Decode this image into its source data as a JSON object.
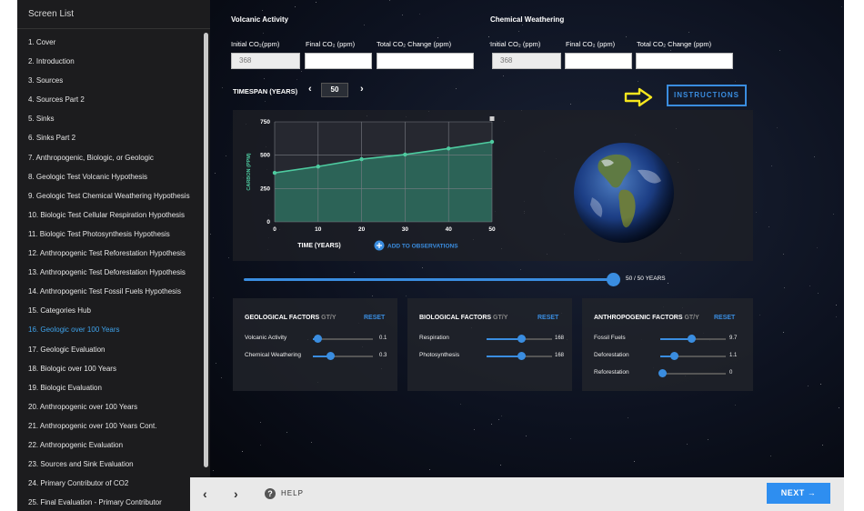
{
  "sidebar": {
    "title": "Screen List",
    "items": [
      "1. Cover",
      "2. Introduction",
      "3. Sources",
      "4. Sources Part 2",
      "5. Sinks",
      "6. Sinks Part 2",
      "7. Anthropogenic, Biologic, or Geologic",
      "8. Geologic Test Volcanic Hypothesis",
      "9. Geologic Test Chemical Weathering Hypothesis",
      "10. Biologic Test Cellular Respiration Hypothesis",
      "11. Biologic Test Photosynthesis Hypothesis",
      "12. Anthropogenic Test Reforestation Hypothesis",
      "13. Anthropogenic Test Deforestation Hypothesis",
      "14. Anthropogenic Test Fossil Fuels Hypothesis",
      "15. Categories Hub",
      "16. Geologic over 100 Years",
      "17. Geologic Evaluation",
      "18. Biologic over 100 Years",
      "19. Biologic Evaluation",
      "20. Anthropogenic over 100 Years",
      "21. Anthropogenic over 100 Years Cont.",
      "22. Anthropogenic Evaluation",
      "23. Sources and Sink Evaluation",
      "24. Primary Contributor of CO2",
      "25. Final Evaluation - Primary Contributor"
    ],
    "active_index": 15
  },
  "volcanic": {
    "title": "Volcanic Activity",
    "initial_label": "Initial CO₂(ppm)",
    "final_label": "Final CO₂ (ppm)",
    "total_label": "Total CO₂ Change  (ppm)",
    "initial_value": "368",
    "final_value": "",
    "total_value": ""
  },
  "weathering": {
    "title": "Chemical Weathering",
    "initial_label": "Initial CO₂ (ppm)",
    "final_label": "Final CO₂ (ppm)",
    "total_label": "Total CO₂ Change  (ppm)",
    "initial_value": "368",
    "final_value": "",
    "total_value": ""
  },
  "timespan": {
    "label": "TIMESPAN (YEARS)",
    "value": "50",
    "prev_glyph": "‹",
    "next_glyph": "›"
  },
  "instructions_label": "INSTRUCTIONS",
  "chart_data": {
    "type": "area",
    "x": [
      0,
      10,
      20,
      30,
      40,
      50
    ],
    "y": [
      368,
      415,
      470,
      505,
      550,
      600
    ],
    "xlabel": "TIME (YEARS)",
    "ylabel": "CARBON (PPM)",
    "xticks": [
      "0",
      "10",
      "20",
      "30",
      "40",
      "50"
    ],
    "yticks": [
      "0",
      "250",
      "500",
      "750"
    ],
    "xlim": [
      0,
      50
    ],
    "ylim": [
      0,
      750
    ],
    "grid": true,
    "line_color": "#4ecba0",
    "fill_color": "#2e6d5e"
  },
  "add_observations_label": "ADD TO OBSERVATIONS",
  "time_slider": {
    "label": "50 / 50 YEARS",
    "value": 50,
    "max": 50
  },
  "factors": {
    "unit": "GT/Y",
    "reset_label": "RESET",
    "geological": {
      "title": "GEOLOGICAL FACTORS",
      "items": [
        {
          "label": "Volcanic Activity",
          "value": "0.1",
          "fraction": 0.04
        },
        {
          "label": "Chemical Weathering",
          "value": "0.3",
          "fraction": 0.3
        }
      ]
    },
    "biological": {
      "title": "BIOLOGICAL FACTORS",
      "items": [
        {
          "label": "Respiration",
          "value": "168",
          "fraction": 0.55
        },
        {
          "label": "Photosynthesis",
          "value": "168",
          "fraction": 0.55
        }
      ]
    },
    "anthropogenic": {
      "title": "ANTHROPOGENIC FACTORS",
      "items": [
        {
          "label": "Fossil Fuels",
          "value": "9.7",
          "fraction": 0.48
        },
        {
          "label": "Deforestation",
          "value": "1.1",
          "fraction": 0.2
        },
        {
          "label": "Reforestation",
          "value": "0",
          "fraction": 0.0
        }
      ]
    }
  },
  "bottom_bar": {
    "help_label": "HELP",
    "next_label": "NEXT →",
    "back_glyph": "‹",
    "forward_glyph": "›",
    "help_glyph": "?"
  },
  "colors": {
    "accent": "#3a8de0",
    "active_item": "#3fa2ea",
    "arrow": "#f5e61e"
  }
}
